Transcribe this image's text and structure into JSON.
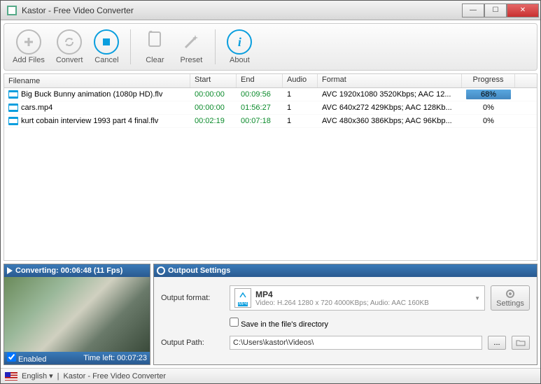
{
  "window": {
    "title": "Kastor - Free Video Converter"
  },
  "toolbar": {
    "addFiles": "Add Files",
    "convert": "Convert",
    "cancel": "Cancel",
    "clear": "Clear",
    "preset": "Preset",
    "about": "About"
  },
  "table": {
    "headers": {
      "filename": "Filename",
      "start": "Start",
      "end": "End",
      "audio": "Audio",
      "format": "Format",
      "progress": "Progress"
    },
    "rows": [
      {
        "filename": "Big Buck Bunny animation (1080p HD).flv",
        "start": "00:00:00",
        "end": "00:09:56",
        "audio": "1",
        "format": "AVC 1920x1080 3520Kbps; AAC 12...",
        "progress": "68%",
        "highlight": true
      },
      {
        "filename": "cars.mp4",
        "start": "00:00:00",
        "end": "01:56:27",
        "audio": "1",
        "format": "AVC 640x272 429Kbps; AAC 128Kb...",
        "progress": "0%",
        "highlight": false
      },
      {
        "filename": "kurt cobain interview 1993 part 4 final.flv",
        "start": "00:02:19",
        "end": "00:07:18",
        "audio": "1",
        "format": "AVC 480x360 386Kbps; AAC 96Kbp...",
        "progress": "0%",
        "highlight": false
      }
    ]
  },
  "preview": {
    "status": "Converting: 00:06:48 (11 Fps)",
    "enabled": "Enabled",
    "timeLeft": "Time left: 00:07:23"
  },
  "settings": {
    "title": "Outpout Settings",
    "outputFormatLabel": "Output format:",
    "formatName": "MP4",
    "formatDesc": "Video: H.264 1280 x 720 4000KBps; Audio: AAC 160KB",
    "settingsBtn": "Settings",
    "saveInDir": "Save in the file's directory",
    "outputPathLabel": "Output Path:",
    "outputPath": "C:\\Users\\kastor\\Videos\\"
  },
  "status": {
    "language": "English",
    "app": "Kastor - Free Video Converter"
  }
}
